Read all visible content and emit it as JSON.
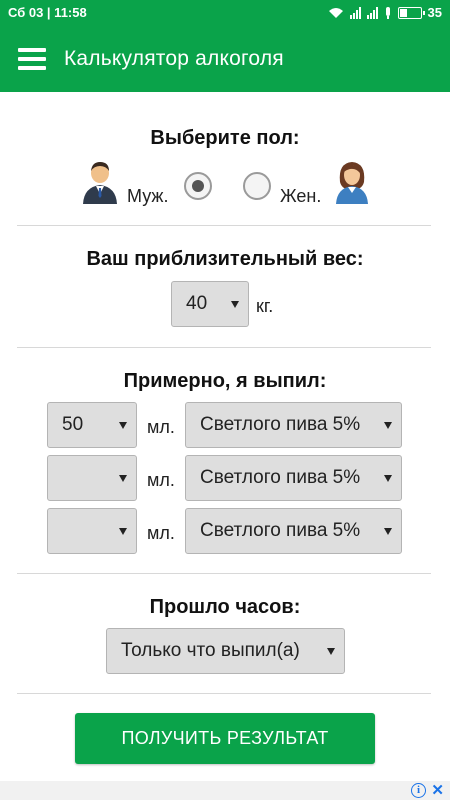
{
  "status_bar": {
    "time": "Сб 03 | 11:58",
    "battery": "35"
  },
  "app_bar": {
    "title": "Калькулятор алкоголя",
    "menu_icon": "hamburger-menu-icon"
  },
  "gender": {
    "title": "Выберите пол:",
    "male_label": "Муж.",
    "female_label": "Жен.",
    "selected": "male"
  },
  "weight": {
    "title": "Ваш приблизительный вес:",
    "value": "40",
    "unit": "кг."
  },
  "drinks": {
    "title": "Примерно, я выпил:",
    "unit": "мл.",
    "rows": [
      {
        "amount": "50",
        "type": "Светлого пива 5%"
      },
      {
        "amount": "",
        "type": "Светлого пива 5%"
      },
      {
        "amount": "",
        "type": "Светлого пива 5%"
      }
    ]
  },
  "hours": {
    "title": "Прошло часов:",
    "value": "Только что выпил(а)"
  },
  "result_button": {
    "label": "ПОЛУЧИТЬ РЕЗУЛЬТАТ"
  },
  "colors": {
    "primary": "#0aa34a",
    "select_bg": "#dedede"
  }
}
